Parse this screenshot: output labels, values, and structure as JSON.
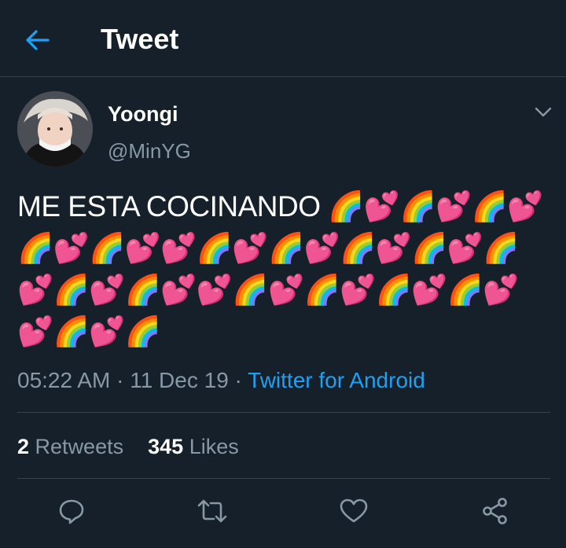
{
  "header": {
    "back_icon": "arrow-left-icon",
    "title": "Tweet"
  },
  "tweet": {
    "author": {
      "display_name": "Yoongi",
      "handle": "@MinYG",
      "avatar": "profile-photo"
    },
    "text": "ME ESTA COCINANDO 🌈💕🌈💕🌈💕🌈💕🌈💕💕🌈💕🌈💕🌈💕🌈💕🌈💕🌈💕🌈💕💕🌈💕🌈💕🌈💕🌈💕💕🌈💕🌈",
    "time": "05:22 AM",
    "date": "11 Dec 19",
    "separator": "·",
    "source": "Twitter for Android",
    "retweets_count": "2",
    "retweets_label": "Retweets",
    "likes_count": "345",
    "likes_label": "Likes"
  },
  "actions": [
    {
      "name": "reply",
      "icon": "speech-bubble-icon"
    },
    {
      "name": "retweet",
      "icon": "retweet-icon"
    },
    {
      "name": "like",
      "icon": "heart-icon"
    },
    {
      "name": "share",
      "icon": "share-icon"
    }
  ],
  "colors": {
    "background": "#15202b",
    "divider": "#38444d",
    "accent": "#1da1f2",
    "secondary_text": "#8899a6",
    "primary_text": "#ffffff"
  }
}
